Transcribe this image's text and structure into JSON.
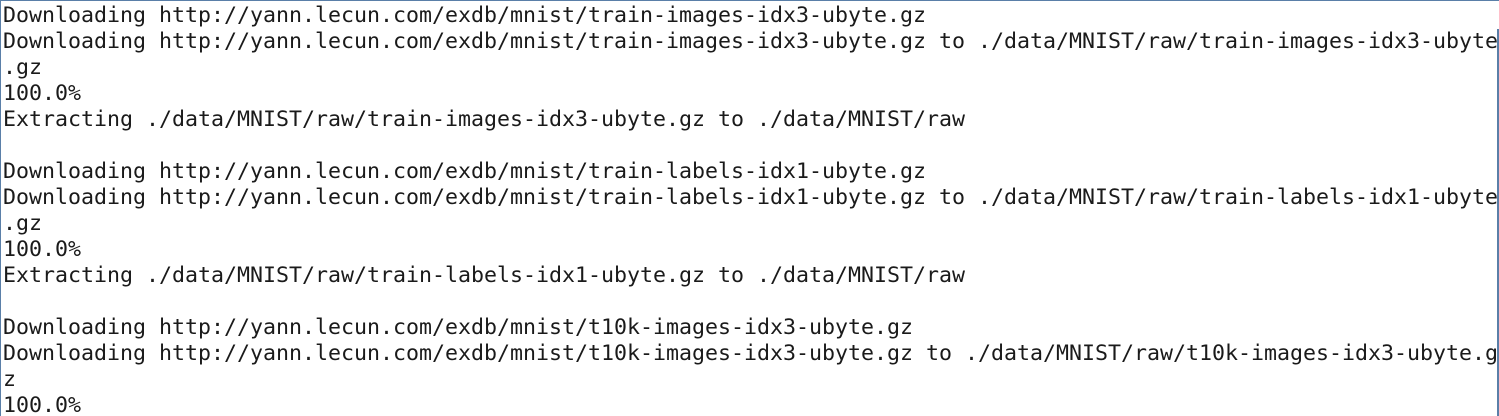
{
  "terminal": {
    "lines": [
      "Downloading http://yann.lecun.com/exdb/mnist/train-images-idx3-ubyte.gz",
      "Downloading http://yann.lecun.com/exdb/mnist/train-images-idx3-ubyte.gz to ./data/MNIST/raw/train-images-idx3-ubyte",
      ".gz",
      "100.0%",
      "Extracting ./data/MNIST/raw/train-images-idx3-ubyte.gz to ./data/MNIST/raw",
      "",
      "Downloading http://yann.lecun.com/exdb/mnist/train-labels-idx1-ubyte.gz",
      "Downloading http://yann.lecun.com/exdb/mnist/train-labels-idx1-ubyte.gz to ./data/MNIST/raw/train-labels-idx1-ubyte",
      ".gz",
      "100.0%",
      "Extracting ./data/MNIST/raw/train-labels-idx1-ubyte.gz to ./data/MNIST/raw",
      "",
      "Downloading http://yann.lecun.com/exdb/mnist/t10k-images-idx3-ubyte.gz",
      "Downloading http://yann.lecun.com/exdb/mnist/t10k-images-idx3-ubyte.gz to ./data/MNIST/raw/t10k-images-idx3-ubyte.g",
      "z",
      "100.0%"
    ]
  }
}
